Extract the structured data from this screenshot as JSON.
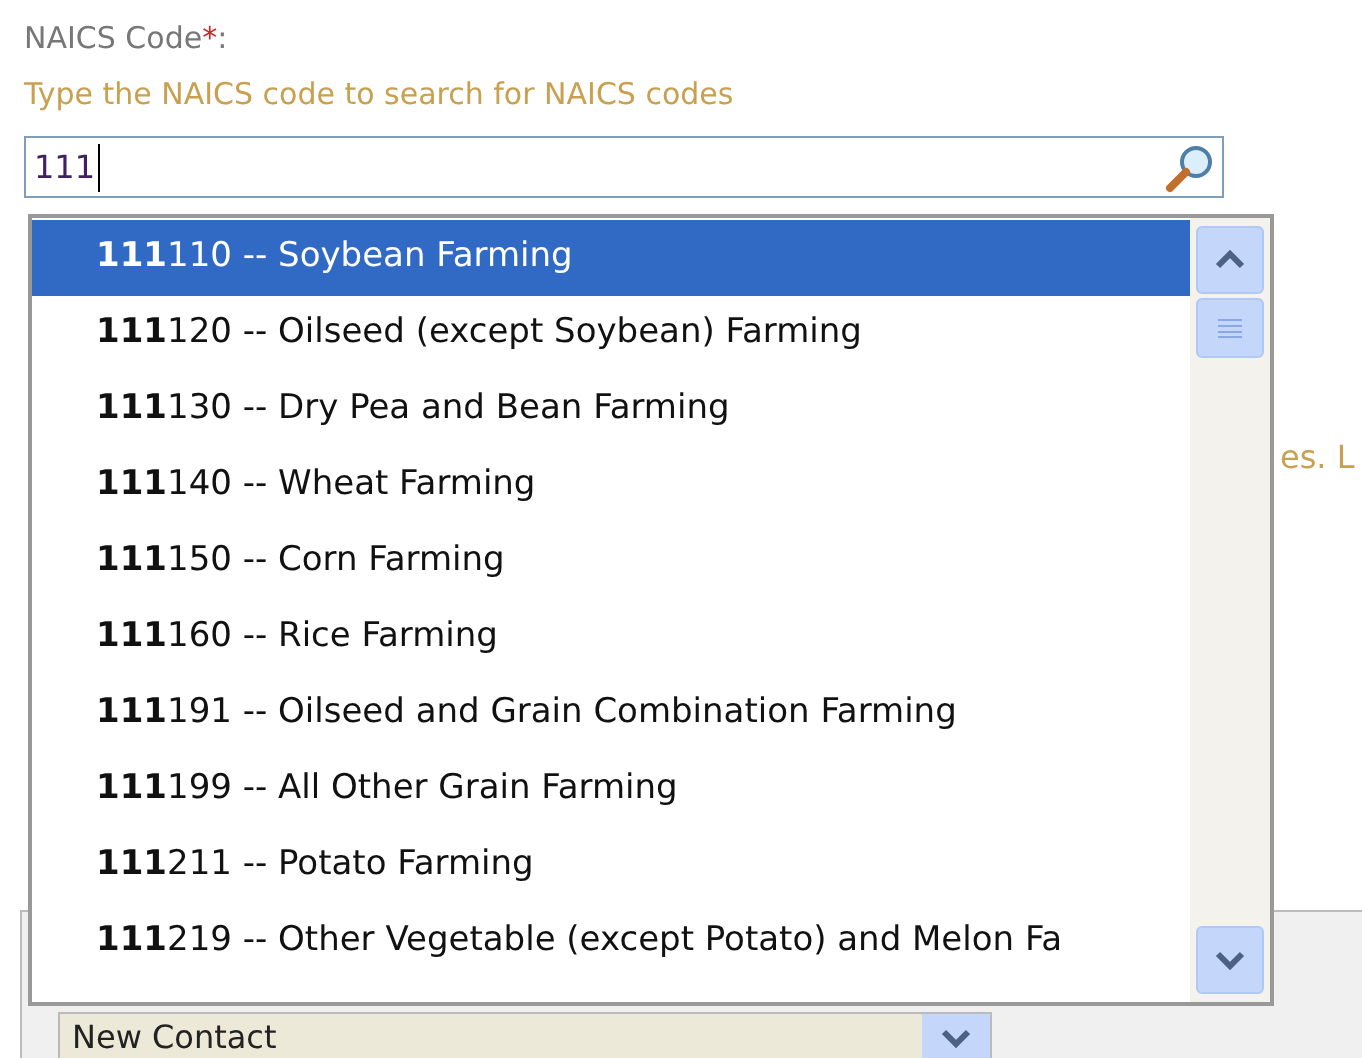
{
  "field": {
    "label": "NAICS Code",
    "required_mark": "*",
    "label_suffix": ":",
    "hint": "Type the NAICS code to search for NAICS codes",
    "value": "111"
  },
  "background_text": "es. L",
  "suggestions": [
    {
      "text": "**111**110 -- Soybean Farming",
      "selected": true
    },
    {
      "text": "**111**120 -- Oilseed (except Soybean) Farming",
      "selected": false
    },
    {
      "text": "**111**130 -- Dry Pea and Bean Farming",
      "selected": false
    },
    {
      "text": "**111**140 -- Wheat Farming",
      "selected": false
    },
    {
      "text": "**111**150 -- Corn Farming",
      "selected": false
    },
    {
      "text": "**111**160 -- Rice Farming",
      "selected": false
    },
    {
      "text": "**111**191 -- Oilseed and Grain Combination Farming",
      "selected": false
    },
    {
      "text": "**111**199 -- All Other Grain Farming",
      "selected": false
    },
    {
      "text": "**111**211 -- Potato Farming",
      "selected": false
    },
    {
      "text": "**111**219 -- Other Vegetable (except Potato) and Melon Fa",
      "selected": false
    }
  ],
  "contact_select": {
    "value": "New Contact"
  }
}
